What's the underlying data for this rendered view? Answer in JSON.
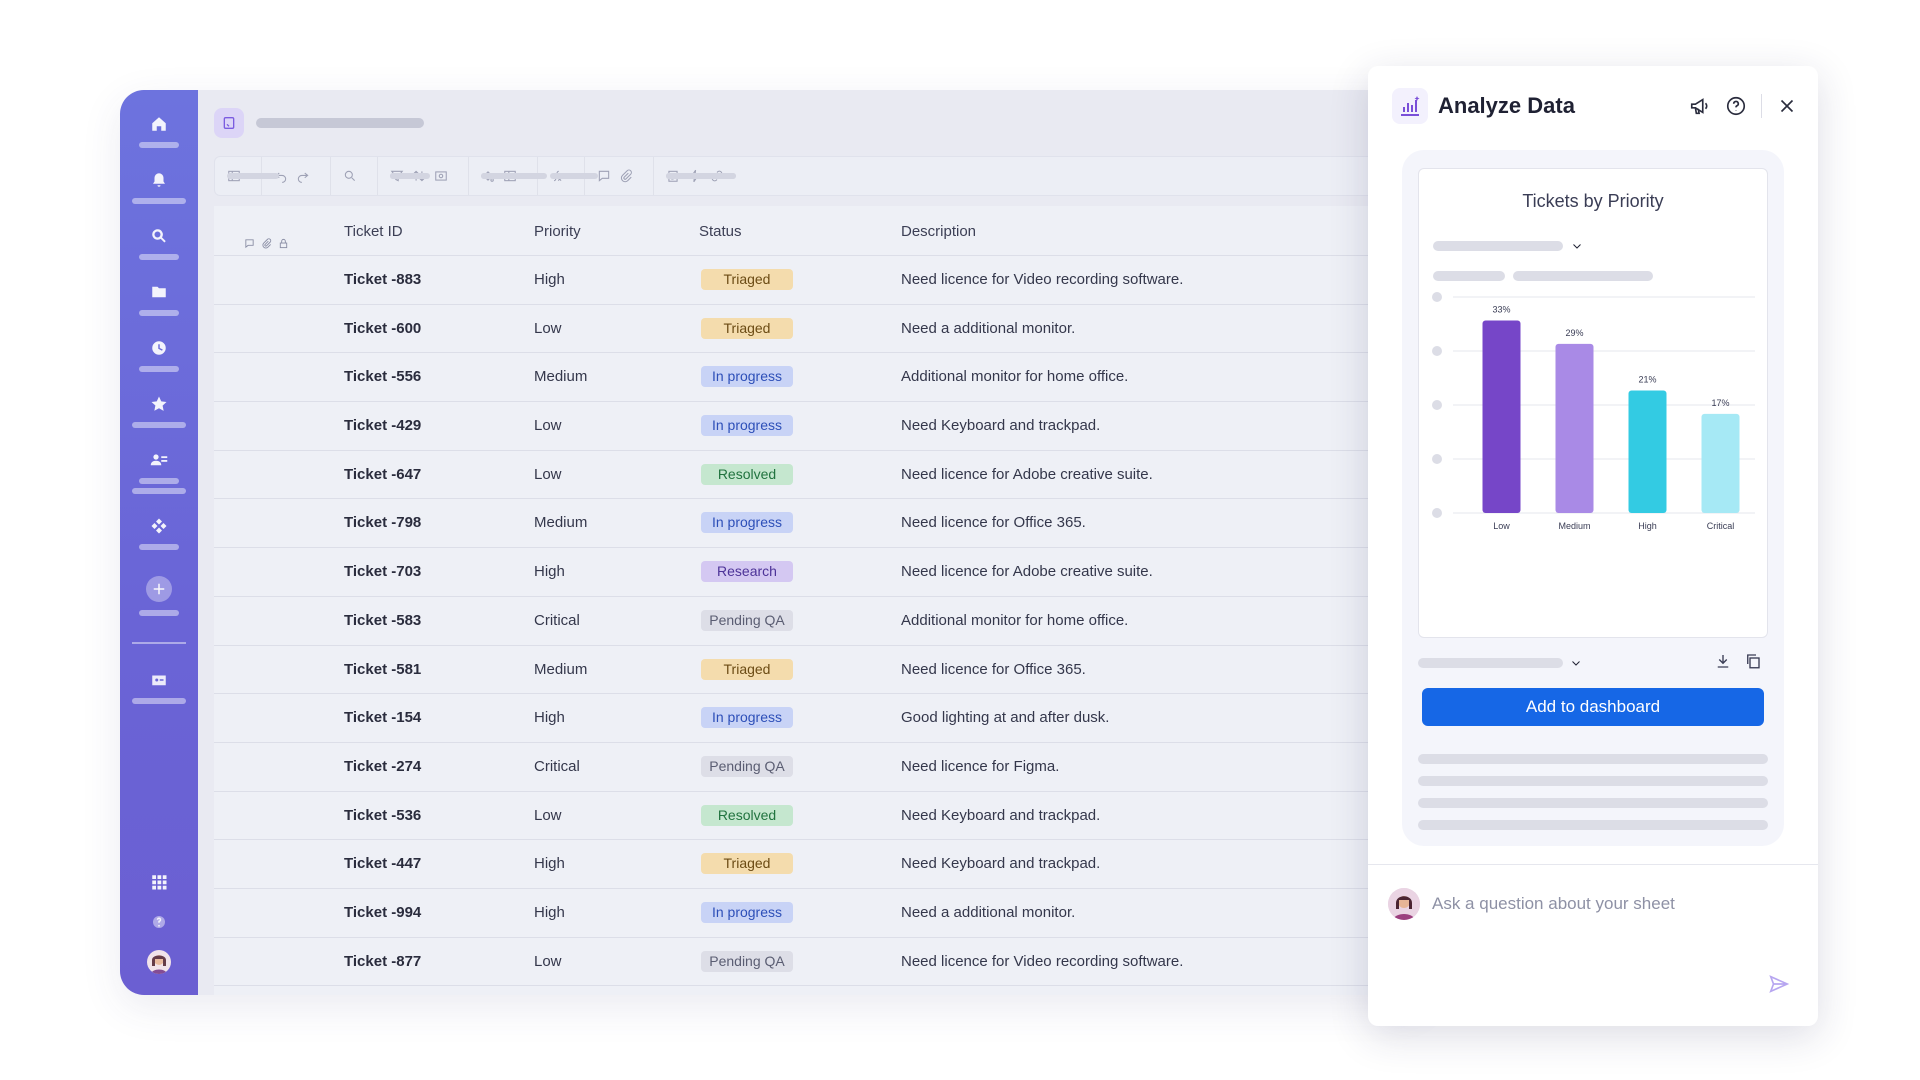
{
  "table": {
    "columns": [
      "Ticket ID",
      "Priority",
      "Status",
      "Description"
    ],
    "rows": [
      {
        "id": "Ticket -883",
        "priority": "High",
        "status": "Triaged",
        "description": "Need licence for Video recording software."
      },
      {
        "id": "Ticket -600",
        "priority": "Low",
        "status": "Triaged",
        "description": "Need a additional monitor."
      },
      {
        "id": "Ticket -556",
        "priority": "Medium",
        "status": "In progress",
        "description": "Additional monitor for home office."
      },
      {
        "id": "Ticket -429",
        "priority": "Low",
        "status": "In progress",
        "description": "Need Keyboard and trackpad."
      },
      {
        "id": "Ticket -647",
        "priority": "Low",
        "status": "Resolved",
        "description": "Need licence for Adobe creative suite."
      },
      {
        "id": "Ticket -798",
        "priority": "Medium",
        "status": "In progress",
        "description": "Need licence for Office 365."
      },
      {
        "id": "Ticket -703",
        "priority": "High",
        "status": "Research",
        "description": "Need licence for Adobe creative suite."
      },
      {
        "id": "Ticket -583",
        "priority": "Critical",
        "status": "Pending QA",
        "description": "Additional monitor for home office."
      },
      {
        "id": "Ticket -581",
        "priority": "Medium",
        "status": "Triaged",
        "description": "Need licence for Office 365."
      },
      {
        "id": "Ticket -154",
        "priority": "High",
        "status": "In progress",
        "description": "Good lighting at and after dusk."
      },
      {
        "id": "Ticket -274",
        "priority": "Critical",
        "status": "Pending QA",
        "description": "Need licence for Figma."
      },
      {
        "id": "Ticket -536",
        "priority": "Low",
        "status": "Resolved",
        "description": "Need Keyboard and trackpad."
      },
      {
        "id": "Ticket -447",
        "priority": "High",
        "status": "Triaged",
        "description": "Need Keyboard and trackpad."
      },
      {
        "id": "Ticket -994",
        "priority": "High",
        "status": "In progress",
        "description": "Need a additional monitor."
      },
      {
        "id": "Ticket -877",
        "priority": "Low",
        "status": "Pending QA",
        "description": "Need licence for Video recording software."
      }
    ]
  },
  "status_styles": {
    "Triaged": {
      "bg": "#f4dcad",
      "fg": "#6b4b14"
    },
    "In progress": {
      "bg": "#c8d3f6",
      "fg": "#2d4fb8"
    },
    "Resolved": {
      "bg": "#c5e7cf",
      "fg": "#21733f"
    },
    "Research": {
      "bg": "#d4c8f2",
      "fg": "#4d3398"
    },
    "Pending QA": {
      "bg": "#dddee7",
      "fg": "#5a5d72"
    }
  },
  "panel": {
    "title": "Analyze Data",
    "button_label": "Add to dashboard",
    "ask_placeholder": "Ask a question about your sheet"
  },
  "chart_data": {
    "type": "bar",
    "title": "Tickets by Priority",
    "categories": [
      "Low",
      "Medium",
      "High",
      "Critical"
    ],
    "values": [
      33,
      29,
      21,
      17
    ],
    "labels": [
      "33%",
      "29%",
      "21%",
      "17%"
    ],
    "colors": [
      "#7646c8",
      "#a98ae6",
      "#33cbe3",
      "#a6e9f5"
    ],
    "ylim": [
      0,
      40
    ],
    "grid": true
  },
  "colors": {
    "accent": "#1667e6",
    "rail": "#6a64d6"
  }
}
